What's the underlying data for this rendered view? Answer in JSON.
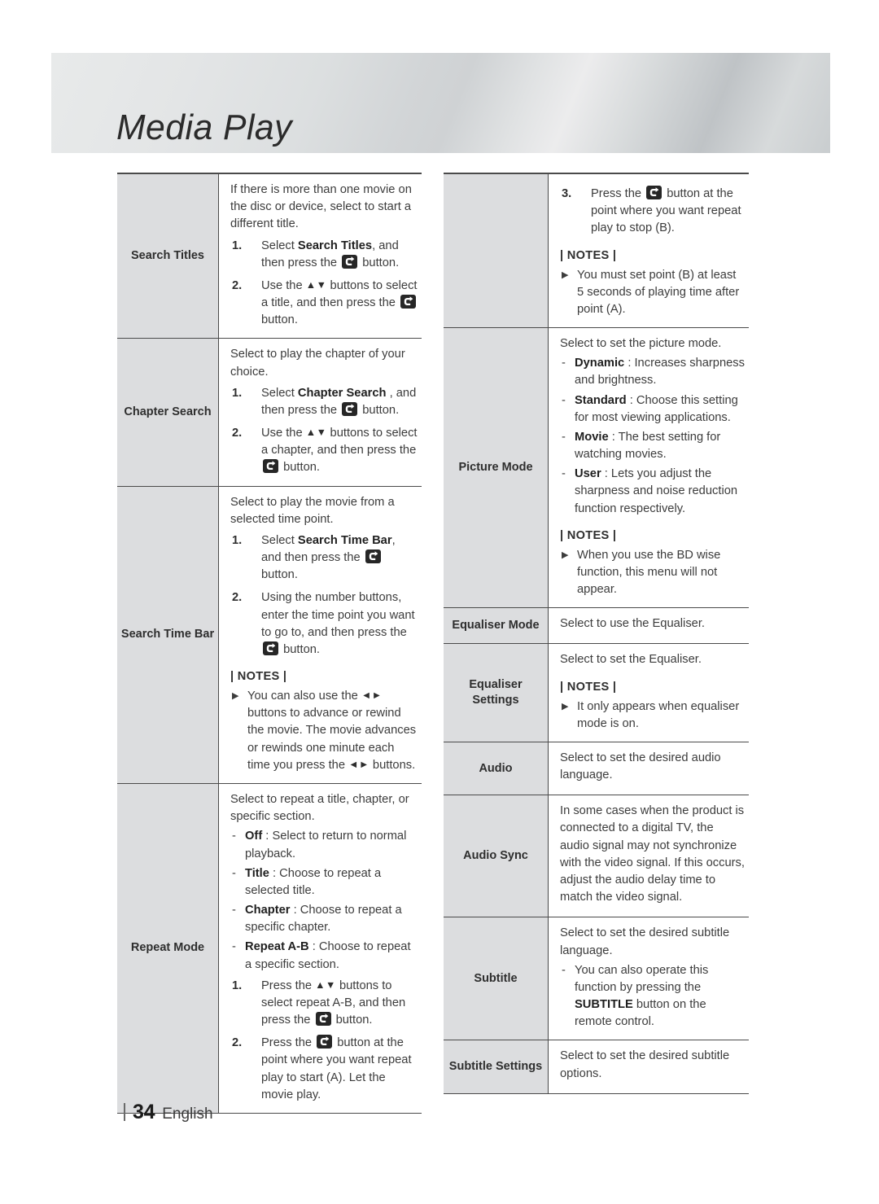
{
  "header": {
    "title": "Media Play"
  },
  "footer": {
    "page_number": "34",
    "language": "English"
  },
  "labels": {
    "notes": "| NOTES |",
    "enter_icon": "enter-button-icon",
    "up_down_arrows": "▲▼",
    "left_right_arrows": "◄►",
    "bullet_triangle": "▶",
    "dash": "-"
  },
  "left_column": {
    "rows": [
      {
        "label": "Search Titles",
        "intro": "If there is more than one movie on the disc or device, select to start a different title.",
        "steps": [
          {
            "num": "1.",
            "parts": [
              {
                "t": "text",
                "v": "Select "
              },
              {
                "t": "kw",
                "v": "Search Titles"
              },
              {
                "t": "text",
                "v": ", and then press the "
              },
              {
                "t": "icon",
                "v": "enter-button-icon"
              },
              {
                "t": "text",
                "v": " button."
              }
            ]
          },
          {
            "num": "2.",
            "parts": [
              {
                "t": "text",
                "v": "Use the "
              },
              {
                "t": "arrows",
                "v": "▲▼"
              },
              {
                "t": "text",
                "v": " buttons to select a title, and then press the "
              },
              {
                "t": "icon",
                "v": "enter-button-icon"
              },
              {
                "t": "text",
                "v": " button."
              }
            ]
          }
        ]
      },
      {
        "label": "Chapter Search",
        "intro": "Select to play the chapter of your choice.",
        "steps": [
          {
            "num": "1.",
            "parts": [
              {
                "t": "text",
                "v": "Select "
              },
              {
                "t": "kw",
                "v": "Chapter Search"
              },
              {
                "t": "text",
                "v": " , and then press the "
              },
              {
                "t": "icon",
                "v": "enter-button-icon"
              },
              {
                "t": "text",
                "v": " button."
              }
            ]
          },
          {
            "num": "2.",
            "parts": [
              {
                "t": "text",
                "v": "Use the "
              },
              {
                "t": "arrows",
                "v": "▲▼"
              },
              {
                "t": "text",
                "v": " buttons to select a chapter, and then press the "
              },
              {
                "t": "icon",
                "v": "enter-button-icon"
              },
              {
                "t": "text",
                "v": " button."
              }
            ]
          }
        ]
      },
      {
        "label": "Search Time Bar",
        "intro": "Select to play the movie from a selected time point.",
        "steps": [
          {
            "num": "1.",
            "parts": [
              {
                "t": "text",
                "v": "Select "
              },
              {
                "t": "kw",
                "v": "Search Time Bar"
              },
              {
                "t": "text",
                "v": ", and then press the "
              },
              {
                "t": "icon",
                "v": "enter-button-icon"
              },
              {
                "t": "text",
                "v": " button."
              }
            ]
          },
          {
            "num": "2.",
            "parts": [
              {
                "t": "text",
                "v": "Using the number buttons, enter the time point you want to go to, and then press the "
              },
              {
                "t": "icon",
                "v": "enter-button-icon"
              },
              {
                "t": "text",
                "v": " button."
              }
            ]
          }
        ],
        "notes": [
          {
            "parts": [
              {
                "t": "text",
                "v": "You can also use the "
              },
              {
                "t": "arrows",
                "v": "◄►"
              },
              {
                "t": "text",
                "v": " buttons to advance or rewind the movie. The movie advances or rewinds one minute each time you press the "
              },
              {
                "t": "arrows",
                "v": "◄►"
              },
              {
                "t": "text",
                "v": " buttons."
              }
            ]
          }
        ]
      },
      {
        "label": "Repeat Mode",
        "intro": "Select to repeat a title, chapter, or specific section.",
        "dashes": [
          {
            "parts": [
              {
                "t": "kw",
                "v": "Off"
              },
              {
                "t": "text",
                "v": " : Select to return to normal playback."
              }
            ]
          },
          {
            "parts": [
              {
                "t": "kw",
                "v": "Title"
              },
              {
                "t": "text",
                "v": " : Choose to repeat a selected title."
              }
            ]
          },
          {
            "parts": [
              {
                "t": "kw",
                "v": "Chapter"
              },
              {
                "t": "text",
                "v": " : Choose to repeat a specific chapter."
              }
            ]
          },
          {
            "parts": [
              {
                "t": "kw",
                "v": "Repeat A-B"
              },
              {
                "t": "text",
                "v": " : Choose to repeat a specific section."
              }
            ]
          }
        ],
        "steps": [
          {
            "num": "1.",
            "parts": [
              {
                "t": "text",
                "v": "Press the "
              },
              {
                "t": "arrows",
                "v": "▲▼"
              },
              {
                "t": "text",
                "v": " buttons to select repeat A-B, and then press the "
              },
              {
                "t": "icon",
                "v": "enter-button-icon"
              },
              {
                "t": "text",
                "v": " button."
              }
            ]
          },
          {
            "num": "2.",
            "parts": [
              {
                "t": "text",
                "v": "Press the "
              },
              {
                "t": "icon",
                "v": "enter-button-icon"
              },
              {
                "t": "text",
                "v": " button at the point where you want repeat play to start (A). Let the movie play."
              }
            ]
          }
        ]
      }
    ]
  },
  "right_column": {
    "rows": [
      {
        "label": "",
        "steps": [
          {
            "num": "3.",
            "parts": [
              {
                "t": "text",
                "v": "Press the "
              },
              {
                "t": "icon",
                "v": "enter-button-icon"
              },
              {
                "t": "text",
                "v": " button at the point where you want repeat play to stop (B)."
              }
            ]
          }
        ],
        "notes": [
          {
            "parts": [
              {
                "t": "text",
                "v": "You must set point (B) at least 5 seconds of playing time after point (A)."
              }
            ]
          }
        ]
      },
      {
        "label": "Picture Mode",
        "intro": "Select to set the picture mode.",
        "dashes": [
          {
            "parts": [
              {
                "t": "kw",
                "v": "Dynamic"
              },
              {
                "t": "text",
                "v": " : Increases sharpness and brightness."
              }
            ]
          },
          {
            "parts": [
              {
                "t": "kw",
                "v": "Standard"
              },
              {
                "t": "text",
                "v": " : Choose this setting for most viewing applications."
              }
            ]
          },
          {
            "parts": [
              {
                "t": "kw",
                "v": "Movie"
              },
              {
                "t": "text",
                "v": " : The best setting for watching movies."
              }
            ]
          },
          {
            "parts": [
              {
                "t": "kw",
                "v": "User"
              },
              {
                "t": "text",
                "v": " : Lets you adjust the sharpness and noise reduction function respectively."
              }
            ]
          }
        ],
        "notes": [
          {
            "parts": [
              {
                "t": "text",
                "v": "When you use the BD wise function, this menu will not appear."
              }
            ]
          }
        ]
      },
      {
        "label": "Equaliser Mode",
        "intro": "Select to use the Equaliser."
      },
      {
        "label": "Equaliser Settings",
        "intro": "Select to set the Equaliser.",
        "notes": [
          {
            "parts": [
              {
                "t": "text",
                "v": "It only appears when equaliser mode is on."
              }
            ]
          }
        ]
      },
      {
        "label": "Audio",
        "intro": "Select to set the desired audio language."
      },
      {
        "label": "Audio Sync",
        "intro": "In some cases when the product is connected to a digital TV, the audio signal may not synchronize with the video signal. If this occurs, adjust the audio delay time to match the video signal."
      },
      {
        "label": "Subtitle",
        "intro": "Select to set the desired subtitle language.",
        "dashes": [
          {
            "parts": [
              {
                "t": "text",
                "v": "You can also operate this function by pressing the "
              },
              {
                "t": "kw",
                "v": "SUBTITLE"
              },
              {
                "t": "text",
                "v": " button on the remote control."
              }
            ]
          }
        ]
      },
      {
        "label": "Subtitle Settings",
        "intro": "Select to set the desired subtitle options."
      }
    ]
  }
}
